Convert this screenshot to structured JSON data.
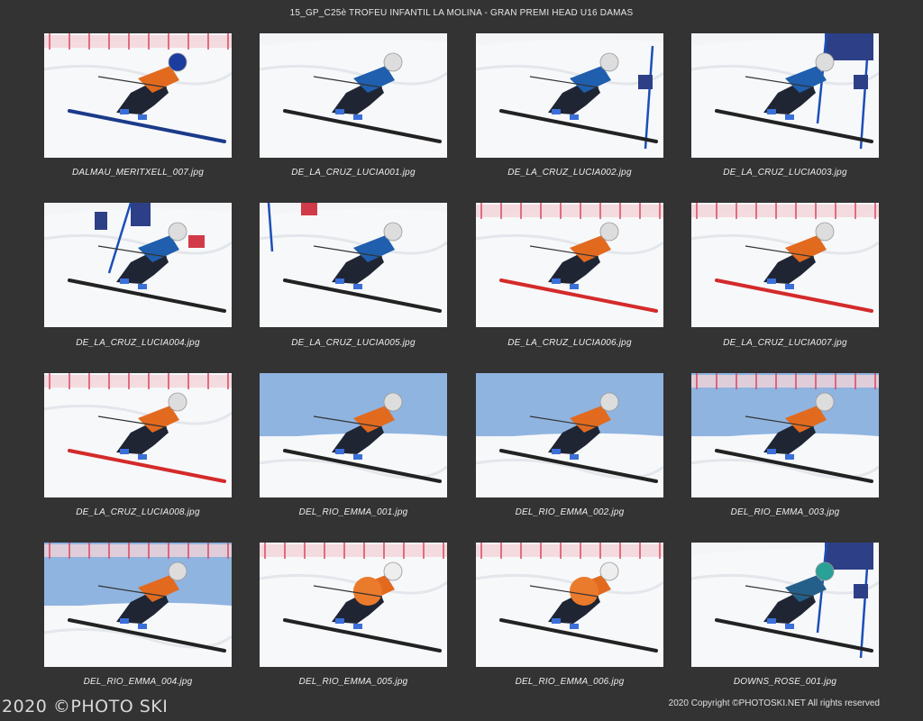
{
  "page": {
    "title": "15_GP_C25è TROFEU INFANTIL LA MOLINA - GRAN PREMI HEAD U16 DAMAS",
    "watermark": "2020 ©PHOTO SKI",
    "copyright": "2020 Copyright ©PHOTOSKI.NET All rights reserved"
  },
  "thumbnails": [
    {
      "caption": "DALMAU_MERITXELL_007.jpg",
      "sky": "none",
      "ski_color": "#1b3a8a",
      "bib": "orange",
      "helmet": "#1c3c9e",
      "pole": "none",
      "fence": "pink",
      "gate_pole": "none"
    },
    {
      "caption": "DE_LA_CRUZ_LUCIA001.jpg",
      "sky": "none",
      "ski_color": "#222222",
      "bib": "blue",
      "helmet": "#dddddd",
      "pole": "none",
      "fence": "none",
      "gate_pole": "none"
    },
    {
      "caption": "DE_LA_CRUZ_LUCIA002.jpg",
      "sky": "none",
      "ski_color": "#222222",
      "bib": "blue",
      "helmet": "#dddddd",
      "pole": "none",
      "fence": "none",
      "gate_pole": "blue"
    },
    {
      "caption": "DE_LA_CRUZ_LUCIA003.jpg",
      "sky": "none",
      "ski_color": "#222222",
      "bib": "blue",
      "helmet": "#dddddd",
      "pole": "none",
      "fence": "none",
      "gate_pole": "bluebanner"
    },
    {
      "caption": "DE_LA_CRUZ_LUCIA004.jpg",
      "sky": "none",
      "ski_color": "#222222",
      "bib": "blue",
      "helmet": "#dddddd",
      "pole": "none",
      "fence": "none",
      "gate_pole": "bluebannerleft"
    },
    {
      "caption": "DE_LA_CRUZ_LUCIA005.jpg",
      "sky": "none",
      "ski_color": "#222222",
      "bib": "blue",
      "helmet": "#dddddd",
      "pole": "none",
      "fence": "none",
      "gate_pole": "leftblue"
    },
    {
      "caption": "DE_LA_CRUZ_LUCIA006.jpg",
      "sky": "none",
      "ski_color": "#d42a2a",
      "bib": "orange",
      "helmet": "#dddddd",
      "pole": "none",
      "fence": "pink",
      "gate_pole": "none"
    },
    {
      "caption": "DE_LA_CRUZ_LUCIA007.jpg",
      "sky": "none",
      "ski_color": "#d42a2a",
      "bib": "orange",
      "helmet": "#dddddd",
      "pole": "none",
      "fence": "pink",
      "gate_pole": "none"
    },
    {
      "caption": "DE_LA_CRUZ_LUCIA008.jpg",
      "sky": "none",
      "ski_color": "#d42a2a",
      "bib": "orange",
      "helmet": "#dddddd",
      "pole": "none",
      "fence": "pink",
      "gate_pole": "none"
    },
    {
      "caption": "DEL_RIO_EMMA_001.jpg",
      "sky": "blue",
      "ski_color": "#222222",
      "bib": "orange",
      "helmet": "#dddddd",
      "pole": "none",
      "fence": "none",
      "gate_pole": "none"
    },
    {
      "caption": "DEL_RIO_EMMA_002.jpg",
      "sky": "blue",
      "ski_color": "#222222",
      "bib": "orange",
      "helmet": "#dddddd",
      "pole": "none",
      "fence": "none",
      "gate_pole": "none"
    },
    {
      "caption": "DEL_RIO_EMMA_003.jpg",
      "sky": "blue",
      "ski_color": "#222222",
      "bib": "orange",
      "helmet": "#dddddd",
      "pole": "none",
      "fence": "pink",
      "gate_pole": "none"
    },
    {
      "caption": "DEL_RIO_EMMA_004.jpg",
      "sky": "blue",
      "ski_color": "#222222",
      "bib": "orange",
      "helmet": "#dddddd",
      "pole": "none",
      "fence": "pink",
      "gate_pole": "none"
    },
    {
      "caption": "DEL_RIO_EMMA_005.jpg",
      "sky": "none",
      "ski_color": "#222222",
      "bib": "orangebig",
      "helmet": "#eeeeee",
      "pole": "none",
      "fence": "pink",
      "gate_pole": "none"
    },
    {
      "caption": "DEL_RIO_EMMA_006.jpg",
      "sky": "none",
      "ski_color": "#222222",
      "bib": "orangebig",
      "helmet": "#eeeeee",
      "pole": "none",
      "fence": "pink",
      "gate_pole": "none"
    },
    {
      "caption": "DOWNS_ROSE_001.jpg",
      "sky": "none",
      "ski_color": "#222222",
      "bib": "teal",
      "helmet": "#2aa198",
      "pole": "none",
      "fence": "none",
      "gate_pole": "bluebanner"
    }
  ]
}
